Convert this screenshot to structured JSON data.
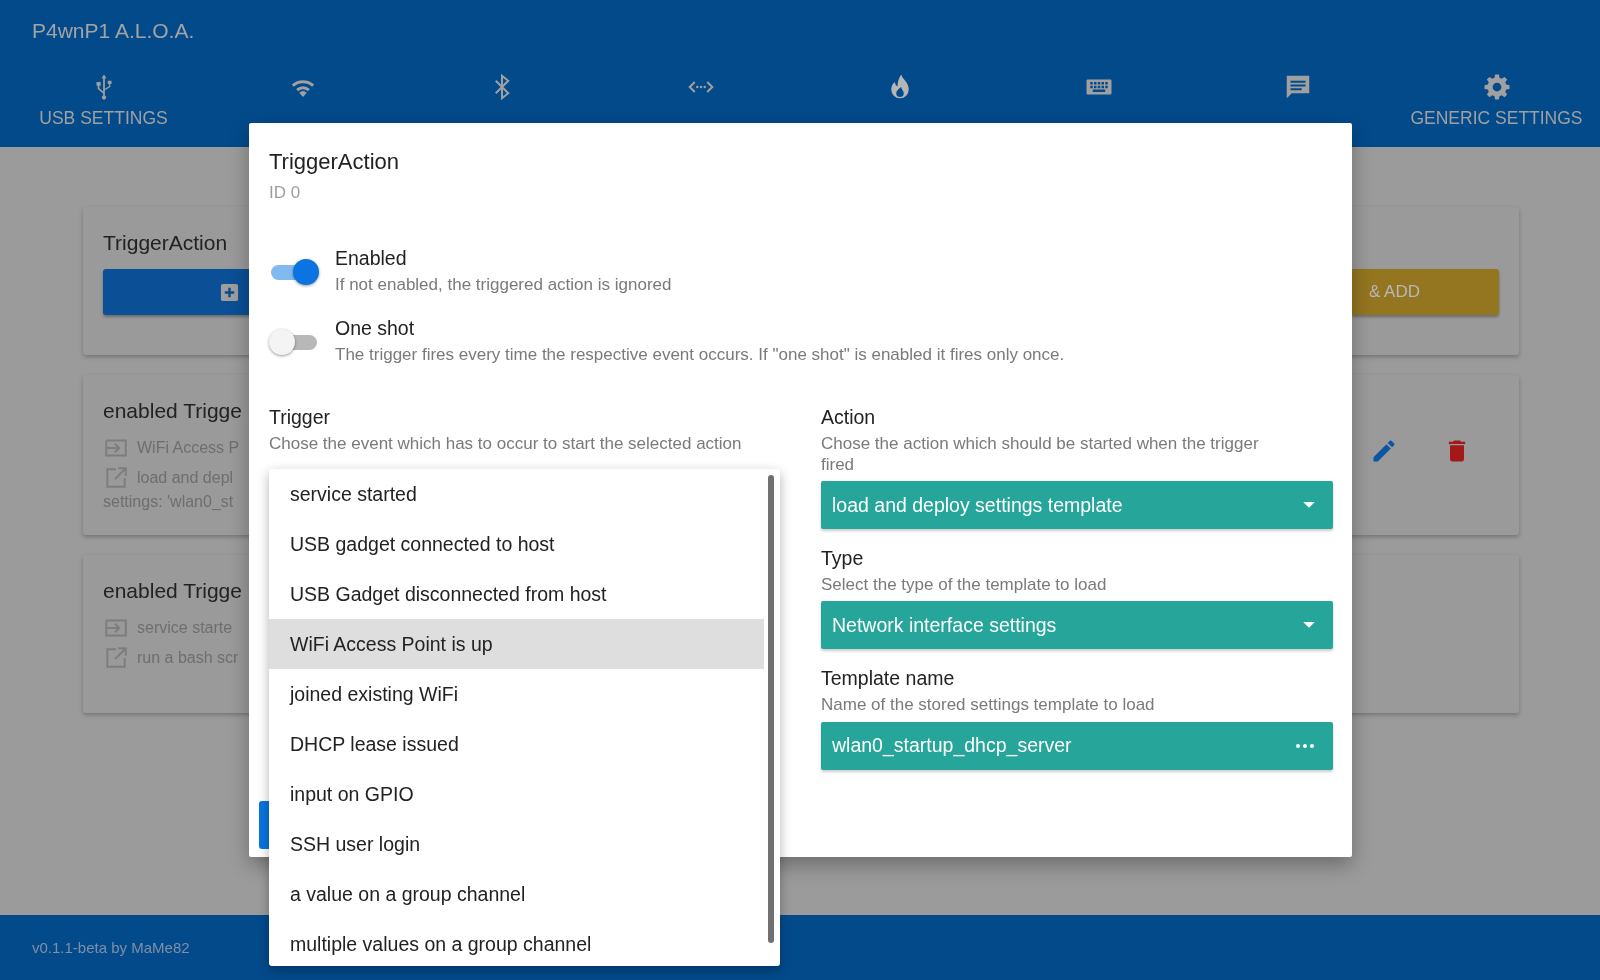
{
  "app": {
    "title": "P4wnP1 A.L.O.A."
  },
  "tabs": [
    {
      "label": "USB SETTINGS",
      "selected": false
    },
    {
      "selected": false
    },
    {
      "selected": false
    },
    {
      "selected": false
    },
    {
      "selected": true
    },
    {
      "selected": false
    },
    {
      "selected": false
    },
    {
      "label": "GENERIC SETTINGS",
      "selected": false
    }
  ],
  "background": {
    "manager_card": {
      "title": "TriggerAction",
      "add_button": "& ADD"
    },
    "trigger_cards": [
      {
        "title": "enabled Trigge",
        "trigger": "WiFi Access P",
        "action": "load and depl",
        "extra": "settings: 'wlan0_st",
        "has_buttons": true
      },
      {
        "title": "enabled Trigge",
        "trigger": "service starte",
        "action": "run a bash scr",
        "has_buttons": false
      }
    ]
  },
  "dialog": {
    "title": "TriggerAction",
    "subtitle": "ID 0",
    "switches": [
      {
        "label": "Enabled",
        "hint": "If not enabled, the triggered action is ignored",
        "on": true
      },
      {
        "label": "One shot",
        "hint": "The trigger fires every time the respective event occurs. If \"one shot\" is enabled it fires only once.",
        "on": false
      }
    ],
    "trigger": {
      "label": "Trigger",
      "hint": "Chose the event which has to occur to start the selected action",
      "options": [
        {
          "label": "service started",
          "selected": false
        },
        {
          "label": "USB gadget connected to host",
          "selected": false
        },
        {
          "label": "USB Gadget disconnected from host",
          "selected": false
        },
        {
          "label": "WiFi Access Point is up",
          "selected": true
        },
        {
          "label": "joined existing WiFi",
          "selected": false
        },
        {
          "label": "DHCP lease issued",
          "selected": false
        },
        {
          "label": "input on GPIO",
          "selected": false
        },
        {
          "label": "SSH user login",
          "selected": false
        },
        {
          "label": "a value on a group channel",
          "selected": false
        },
        {
          "label": "multiple values on a group channel",
          "selected": false
        }
      ]
    },
    "fields": [
      {
        "label": "Action",
        "hint": "Chose the action which should be started when the trigger fired",
        "value": "load and deploy settings template",
        "kind": "select"
      },
      {
        "label": "Type",
        "hint": "Select the type of the template to load",
        "value": "Network interface settings",
        "kind": "select"
      },
      {
        "label": "Template name",
        "hint": "Name of the stored settings template to load",
        "value": "wlan0_startup_dhcp_server",
        "kind": "picker"
      }
    ]
  },
  "footer": {
    "text": "v0.1.1-beta by MaMe82"
  }
}
